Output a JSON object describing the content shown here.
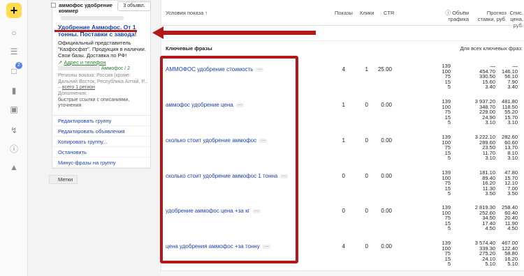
{
  "sidebar": {
    "add_label": "+",
    "icons": [
      "user-icon",
      "list-icon",
      "cart-icon",
      "chart-icon",
      "briefcase-icon",
      "wrench-icon",
      "info-icon",
      "thumbs-up-icon"
    ],
    "badge_count": "2"
  },
  "group": {
    "name": "аммофос удобрение коммер",
    "ads_button": "3 объявл.",
    "ad_title": "Удобрение Аммофос. От 1 тонны. Поставки с завода!",
    "ad_text": "Официальный представитель \"Казфосфат\". Продукция в наличии. Свои базы. Доставка по РФ!",
    "ad_link": "Адрес и телефон",
    "ad_sub": "Аммофос / 2",
    "regions_label": "Регионы показа: Россия (кроме: Дальний Восток, Республика Алтай, Р...",
    "regions_more": "всего 1 регион",
    "addons_label": "Дополнения:",
    "addons_value": "быстрые ссылки с описаниями, уточнения",
    "menu": [
      "Редактировать группу",
      "Редактировать объявления",
      "Копировать группу...",
      "Остановить",
      "Минус-фразы на группу"
    ]
  },
  "labels_button": "Метки",
  "table": {
    "headers": {
      "conditions": "Условия показа ↑",
      "shows": "Показы",
      "clicks": "Клики",
      "ctr": "CTR",
      "traffic": "Объём трафика",
      "forecast": "Прогноз ставки, руб.",
      "charge": "Спис. цена, руб."
    },
    "section": "Ключевые фразы",
    "section_right": "Для всех ключевых фраз:",
    "rows": [
      {
        "keyword": "АММОФОС удобрение стоимость",
        "shows": "4",
        "clicks": "1",
        "ctr": "25.00",
        "traffic": [
          "139",
          "100",
          "75",
          "15",
          "5"
        ],
        "forecast": [
          "—",
          "454.70",
          "330.50",
          "15.60",
          "3.40"
        ],
        "charge": [
          "—",
          "146.10",
          "56.10",
          "7.90",
          "3.40"
        ]
      },
      {
        "keyword": "аммофос удобрение цена",
        "shows": "1",
        "clicks": "0",
        "ctr": "0.00",
        "traffic": [
          "139",
          "100",
          "75",
          "15",
          "5"
        ],
        "forecast": [
          "3 937.20",
          "348.70",
          "229.00",
          "24.90",
          "3.10"
        ],
        "charge": [
          "481.80",
          "118.50",
          "55.20",
          "15.70",
          "3.10"
        ]
      },
      {
        "keyword": "сколько стоит удобрение аммофос",
        "shows": "1",
        "clicks": "0",
        "ctr": "0.00",
        "traffic": [
          "139",
          "100",
          "75",
          "15",
          "5"
        ],
        "forecast": [
          "3 222.10",
          "289.60",
          "23.50",
          "11.70",
          "3.10"
        ],
        "charge": [
          "282.60",
          "60.60",
          "13.70",
          "8.10",
          "3.10"
        ]
      },
      {
        "keyword": "сколько стоит удобрение аммофос 1 тонна",
        "shows": "0",
        "clicks": "0",
        "ctr": "0.00",
        "traffic": [
          "139",
          "100",
          "75",
          "15",
          "5"
        ],
        "forecast": [
          "181.10",
          "89.40",
          "16.20",
          "11.30",
          "3.50"
        ],
        "charge": [
          "47.80",
          "15.70",
          "12.10",
          "7.00",
          "3.50"
        ]
      },
      {
        "keyword": "удобрение аммофос цена +за кг",
        "shows": "0",
        "clicks": "0",
        "ctr": "0.00",
        "traffic": [
          "139",
          "100",
          "75",
          "15",
          "5"
        ],
        "forecast": [
          "2 819.30",
          "252.60",
          "34.50",
          "17.40",
          "4.50"
        ],
        "charge": [
          "258.40",
          "60.40",
          "20.40",
          "11.90",
          "4.50"
        ]
      },
      {
        "keyword": "цена удобрения аммофос +за тонну",
        "shows": "4",
        "clicks": "0",
        "ctr": "0.00",
        "traffic": [
          "139",
          "100",
          "75",
          "15",
          "5"
        ],
        "forecast": [
          "3 574.40",
          "339.30",
          "275.20",
          "24.10",
          "5.10"
        ],
        "charge": [
          "467.00",
          "122.40",
          "58.80",
          "16.20",
          "5.10"
        ]
      }
    ]
  },
  "colors": {
    "accent": "#ffdb4d",
    "link": "#1a3fb5",
    "highlight": "#b21a1a",
    "green": "#2e7d32"
  }
}
